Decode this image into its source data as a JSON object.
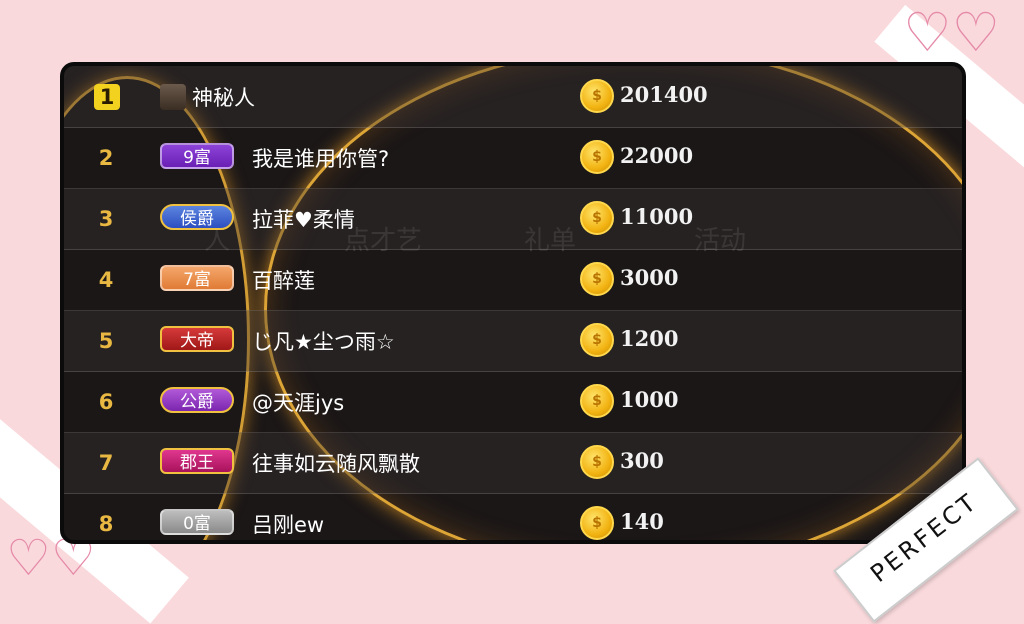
{
  "leaderboard": {
    "rows": [
      {
        "rank": "1",
        "badge": "",
        "name": "神秘人",
        "amount": "201400"
      },
      {
        "rank": "2",
        "badge": "9富",
        "name": "我是谁用你管?",
        "amount": "22000"
      },
      {
        "rank": "3",
        "badge": "侯爵",
        "name": "拉菲♥柔情",
        "amount": "11000"
      },
      {
        "rank": "4",
        "badge": "7富",
        "name": "百醉莲",
        "amount": "3000"
      },
      {
        "rank": "5",
        "badge": "大帝",
        "name": "じ凡★尘つ雨☆",
        "amount": "1200"
      },
      {
        "rank": "6",
        "badge": "公爵",
        "name": "@天涯jys",
        "amount": "1000"
      },
      {
        "rank": "7",
        "badge": "郡王",
        "name": "往事如云随风飘散",
        "amount": "300"
      },
      {
        "rank": "8",
        "badge": "0富",
        "name": "吕刚ew",
        "amount": "140"
      }
    ],
    "coin_glyph": "$"
  },
  "background_tabs": [
    "人",
    "点才艺",
    "礼单",
    "活动"
  ],
  "decor": {
    "stamp_text": "PERFECT",
    "heart_icon": "heart-outline-icon"
  }
}
